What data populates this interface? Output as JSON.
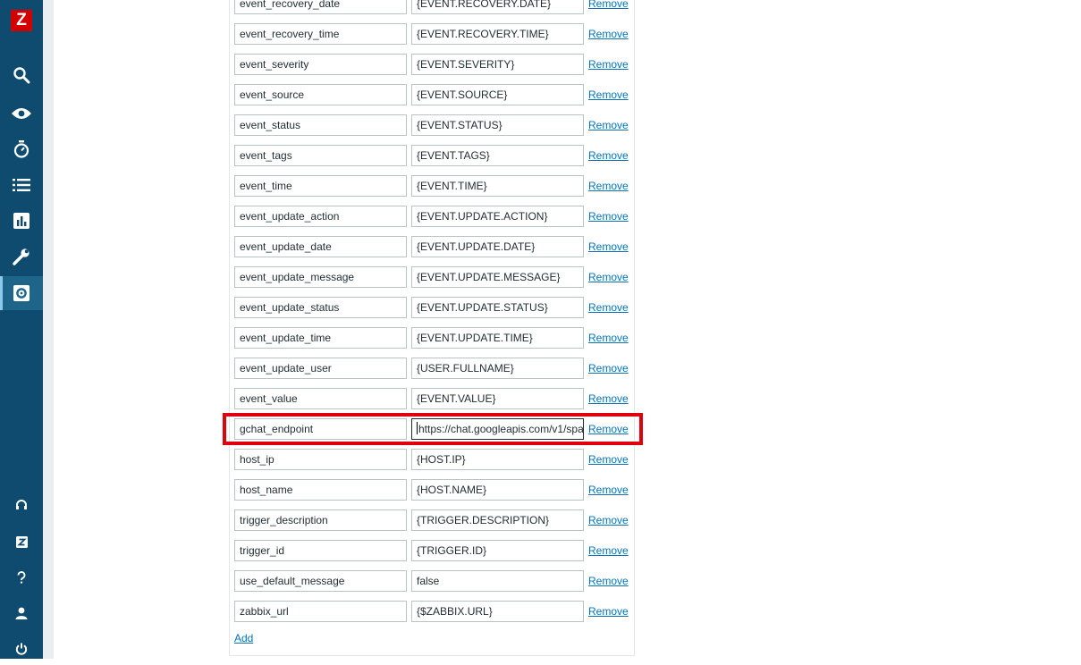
{
  "sidebar": {
    "logo_letter": "Z",
    "icons": [
      "search-icon",
      "monitoring-eye-icon",
      "services-timer-icon",
      "inventory-list-icon",
      "reports-chart-icon",
      "data-collection-wrench-icon",
      "administration-gear-icon",
      "support-headset-icon",
      "zabbix-share-icon",
      "help-icon",
      "user-settings-icon",
      "sign-out-icon"
    ],
    "active_icon": "administration-gear-icon"
  },
  "parameters": [
    {
      "name": "event_recovery_date",
      "value": "{EVENT.RECOVERY.DATE}"
    },
    {
      "name": "event_recovery_time",
      "value": "{EVENT.RECOVERY.TIME}"
    },
    {
      "name": "event_severity",
      "value": "{EVENT.SEVERITY}"
    },
    {
      "name": "event_source",
      "value": "{EVENT.SOURCE}"
    },
    {
      "name": "event_status",
      "value": "{EVENT.STATUS}"
    },
    {
      "name": "event_tags",
      "value": "{EVENT.TAGS}"
    },
    {
      "name": "event_time",
      "value": "{EVENT.TIME}"
    },
    {
      "name": "event_update_action",
      "value": "{EVENT.UPDATE.ACTION}"
    },
    {
      "name": "event_update_date",
      "value": "{EVENT.UPDATE.DATE}"
    },
    {
      "name": "event_update_message",
      "value": "{EVENT.UPDATE.MESSAGE}"
    },
    {
      "name": "event_update_status",
      "value": "{EVENT.UPDATE.STATUS}"
    },
    {
      "name": "event_update_time",
      "value": "{EVENT.UPDATE.TIME}"
    },
    {
      "name": "event_update_user",
      "value": "{USER.FULLNAME}"
    },
    {
      "name": "event_value",
      "value": "{EVENT.VALUE}"
    },
    {
      "name": "gchat_endpoint",
      "value": "https://chat.googleapis.com/v1/spa"
    },
    {
      "name": "host_ip",
      "value": "{HOST.IP}"
    },
    {
      "name": "host_name",
      "value": "{HOST.NAME}"
    },
    {
      "name": "trigger_description",
      "value": "{TRIGGER.DESCRIPTION}"
    },
    {
      "name": "trigger_id",
      "value": "{TRIGGER.ID}"
    },
    {
      "name": "use_default_message",
      "value": "false"
    },
    {
      "name": "zabbix_url",
      "value": "{$ZABBIX.URL}"
    }
  ],
  "remove_label": "Remove",
  "add_label": "Add",
  "highlight_color": "#e0000d",
  "accent_color": "#0275b8"
}
